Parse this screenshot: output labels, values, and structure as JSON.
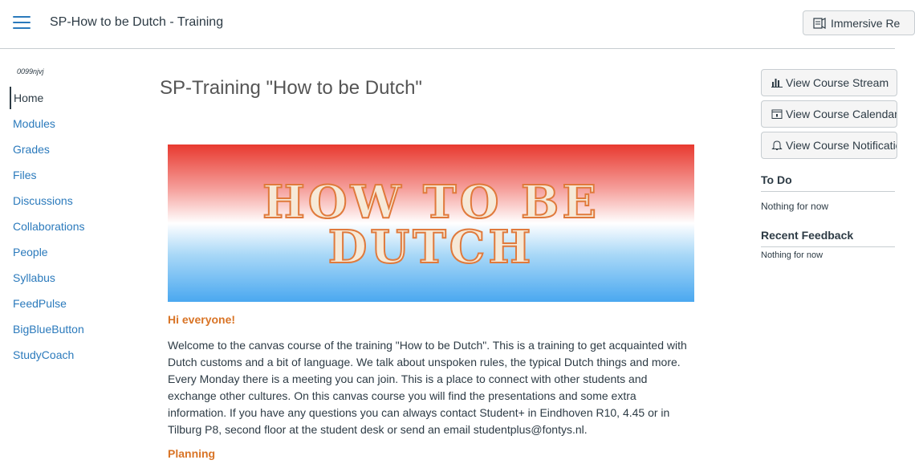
{
  "header": {
    "course_title": "SP-How to be Dutch - Training",
    "immersive_label": "Immersive Re"
  },
  "nav": {
    "code": "0099njvj",
    "items": [
      {
        "label": "Home",
        "active": true
      },
      {
        "label": "Modules"
      },
      {
        "label": "Grades"
      },
      {
        "label": "Files"
      },
      {
        "label": "Discussions"
      },
      {
        "label": "Collaborations"
      },
      {
        "label": "People"
      },
      {
        "label": "Syllabus"
      },
      {
        "label": "FeedPulse"
      },
      {
        "label": "BigBlueButton"
      },
      {
        "label": "StudyCoach"
      }
    ]
  },
  "main": {
    "page_title": "SP-Training \"How to be Dutch\"",
    "banner": {
      "line1": "HOW TO BE",
      "line2": "DUTCH"
    },
    "greeting": "Hi everyone!",
    "intro": "Welcome to the canvas course of the training \"How to be Dutch\". This is a training to get acquainted with Dutch customs and a bit of language. We talk about unspoken rules, the typical Dutch things and more. Every Monday there is a meeting you can join. This is a place to connect with other students and exchange other cultures. On this canvas course you will find the presentations and some extra information. If you have any questions you can always contact Student+ in Eindhoven R10, 4.45 or in Tilburg P8, second floor at the student desk or send an email studentplus@fontys.nl.",
    "planning_heading": "Planning"
  },
  "sidebar": {
    "stream_button": "View Course Stream",
    "calendar_button": "View Course Calendar",
    "notifications_button": "View Course Notifications",
    "todo_heading": "To Do",
    "todo_empty": "Nothing for now",
    "feedback_heading": "Recent Feedback",
    "feedback_empty": "Nothing for now"
  },
  "colors": {
    "link": "#2b7abc",
    "accent_orange": "#d97426",
    "text": "#2d3b45"
  }
}
